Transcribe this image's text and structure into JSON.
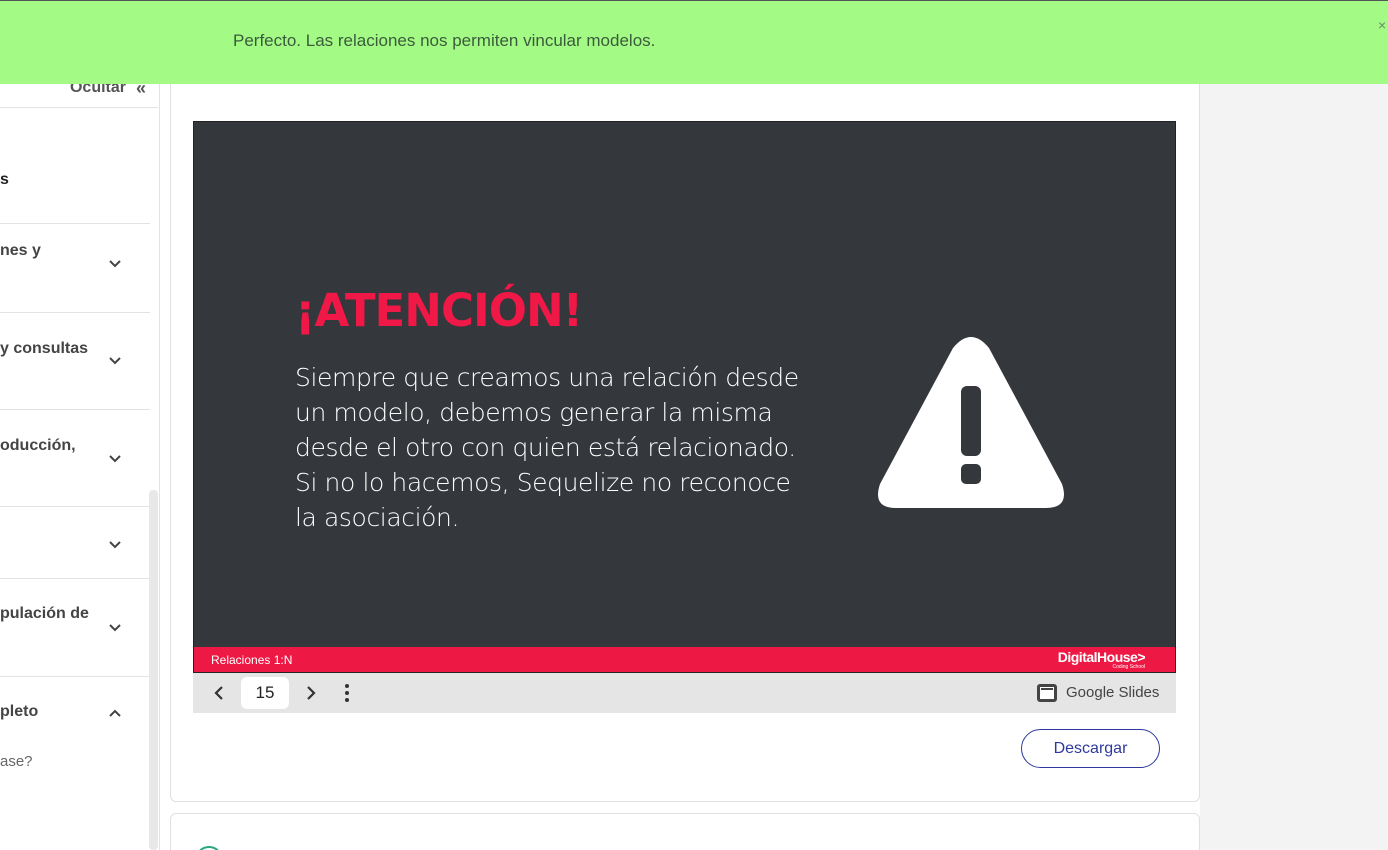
{
  "banner": {
    "message": "Perfecto. Las relaciones nos permiten vincular modelos.",
    "close": "×"
  },
  "sidebar": {
    "hide_label": "Ocultar",
    "hide_chevron": "«",
    "section_title": "s",
    "items": [
      {
        "label_line1": "nes y",
        "label_line2": "",
        "expanded": false
      },
      {
        "label_line1": "y consultas",
        "label_line2": "",
        "expanded": false
      },
      {
        "label_line1": "oducción,",
        "label_line2": "",
        "expanded": false
      },
      {
        "label_line1": "",
        "label_line2": "",
        "expanded": false
      },
      {
        "label_line1": "pulación de",
        "label_line2": "",
        "expanded": false
      },
      {
        "label_line1": "pleto",
        "label_line2": "",
        "expanded": true
      }
    ],
    "sub_item": "ase?"
  },
  "slide": {
    "heading": "¡ATENCIÓN!",
    "body": "Siempre que creamos una relación desde un modelo, debemos generar la misma desde el otro con quien está relacionado. Si no lo hacemos, Sequelize no reconoce la asociación.",
    "footer_label": "Relaciones 1:N",
    "brand": "DigitalHouse>",
    "brand_sub": "Coding School"
  },
  "slides_toolbar": {
    "page": "15",
    "app_label": "Google Slides"
  },
  "actions": {
    "download": "Descargar"
  },
  "colors": {
    "banner": "#a3fb85",
    "slide_bg": "#34373b",
    "accent_red": "#ef1846",
    "button": "#2e3a9c"
  }
}
